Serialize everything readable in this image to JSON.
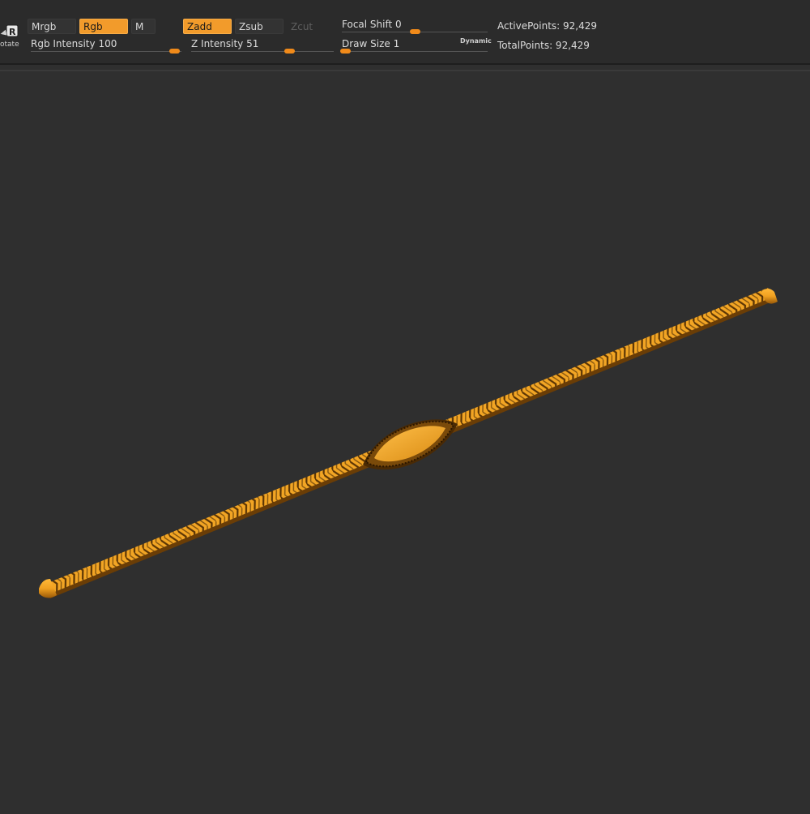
{
  "toolbar": {
    "rotate_label": "otate",
    "mrgb": "Mrgb",
    "rgb": "Rgb",
    "m": "M",
    "zadd": "Zadd",
    "zsub": "Zsub",
    "zcut": "Zcut",
    "rgb_intensity_label": "Rgb Intensity",
    "rgb_intensity_value": "100",
    "z_intensity_label": "Z Intensity",
    "z_intensity_value": "51",
    "focal_shift_label": "Focal Shift",
    "focal_shift_value": "0",
    "draw_size_label": "Draw Size",
    "draw_size_value": "1",
    "dynamic_label": "Dynamic",
    "active_points": "ActivePoints: 92,429",
    "total_points": "TotalPoints: 92,429"
  },
  "levels": {
    "rgb_intensity": 100,
    "z_intensity": 51,
    "focal_shift": 0,
    "draw_size": 1
  },
  "colors": {
    "accent": "#f29b2b",
    "model_gold": "#f0a020",
    "background": "#2f2f2f"
  },
  "icons": {
    "rotate": "rotate-icon"
  }
}
